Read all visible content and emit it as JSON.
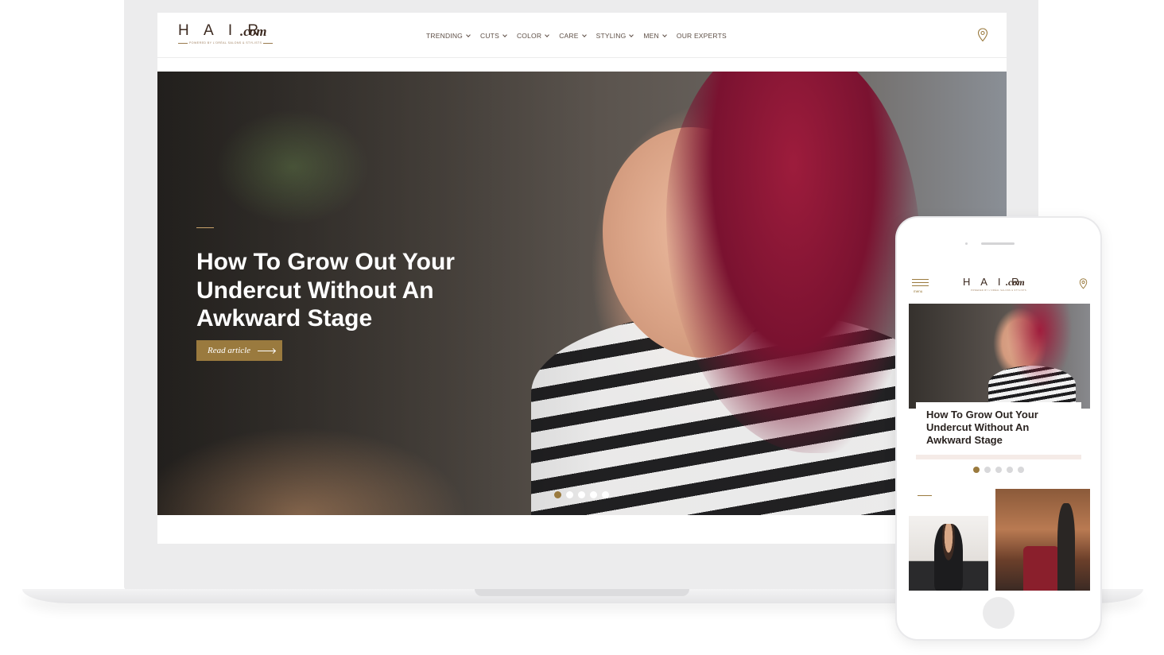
{
  "site": {
    "logo_main": "H A I R",
    "logo_suffix": ".com",
    "logo_tagline": "POWERED BY L'ORÉAL SALONS & STYLISTS"
  },
  "nav": {
    "items": [
      {
        "label": "TRENDING",
        "has_dropdown": true
      },
      {
        "label": "CUTS",
        "has_dropdown": true
      },
      {
        "label": "COLOR",
        "has_dropdown": true
      },
      {
        "label": "CARE",
        "has_dropdown": true
      },
      {
        "label": "STYLING",
        "has_dropdown": true
      },
      {
        "label": "MEN",
        "has_dropdown": true
      },
      {
        "label": "OUR EXPERTS",
        "has_dropdown": false
      }
    ],
    "location_icon": "location-pin-icon"
  },
  "hero": {
    "title": "How To Grow Out Your Undercut Without An Awkward Stage",
    "button_label": "Read article",
    "slides_total": 5,
    "active_slide": 1
  },
  "mobile": {
    "menu_label": "menu",
    "card_title": "How To Grow Out Your Undercut Without An Awkward Stage",
    "slides_total": 5,
    "active_slide": 1
  },
  "colors": {
    "accent": "#9a7a3e",
    "logo": "#3c2a20",
    "nav_text": "#5e4f46"
  }
}
